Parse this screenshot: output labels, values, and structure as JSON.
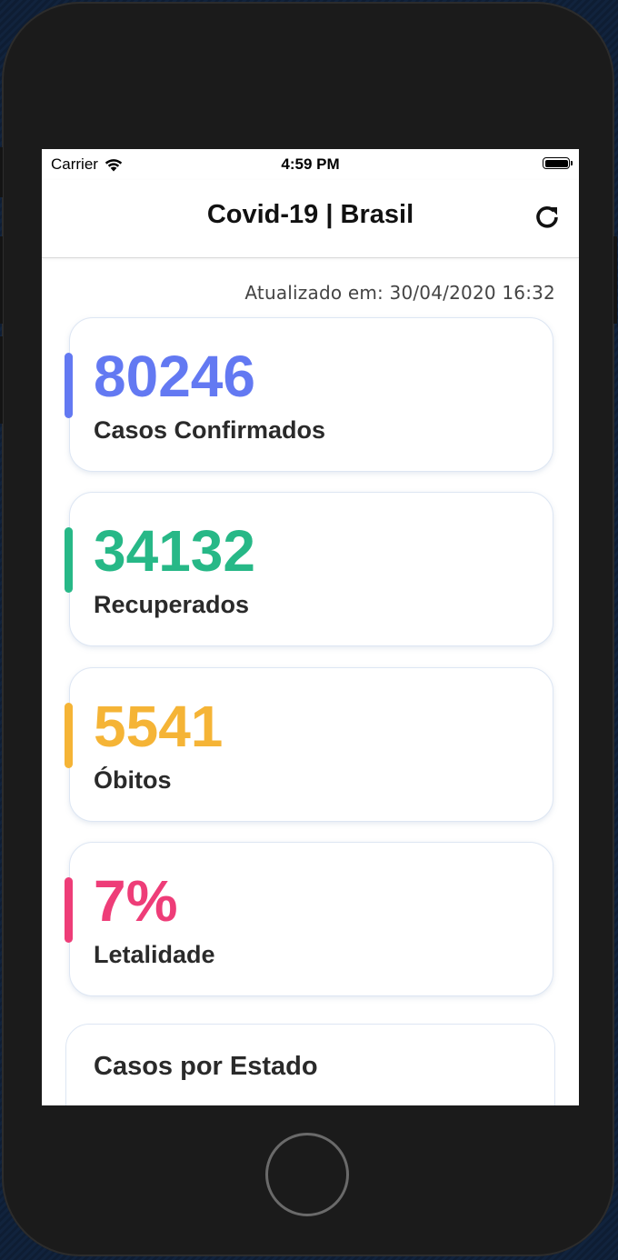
{
  "status_bar": {
    "carrier": "Carrier",
    "time": "4:59 PM"
  },
  "nav": {
    "title": "Covid-19 | Brasil",
    "refresh_icon": "refresh-icon"
  },
  "updated_text": "Atualizado em: 30/04/2020 16:32",
  "cards": [
    {
      "value": "80246",
      "label": "Casos Confirmados",
      "color": "#6379f2"
    },
    {
      "value": "34132",
      "label": "Recuperados",
      "color": "#27b887"
    },
    {
      "value": "5541",
      "label": "Óbitos",
      "color": "#f5b436"
    },
    {
      "value": "7%",
      "label": "Letalidade",
      "color": "#ee3d78"
    }
  ],
  "state_section": {
    "title": "Casos por Estado"
  }
}
